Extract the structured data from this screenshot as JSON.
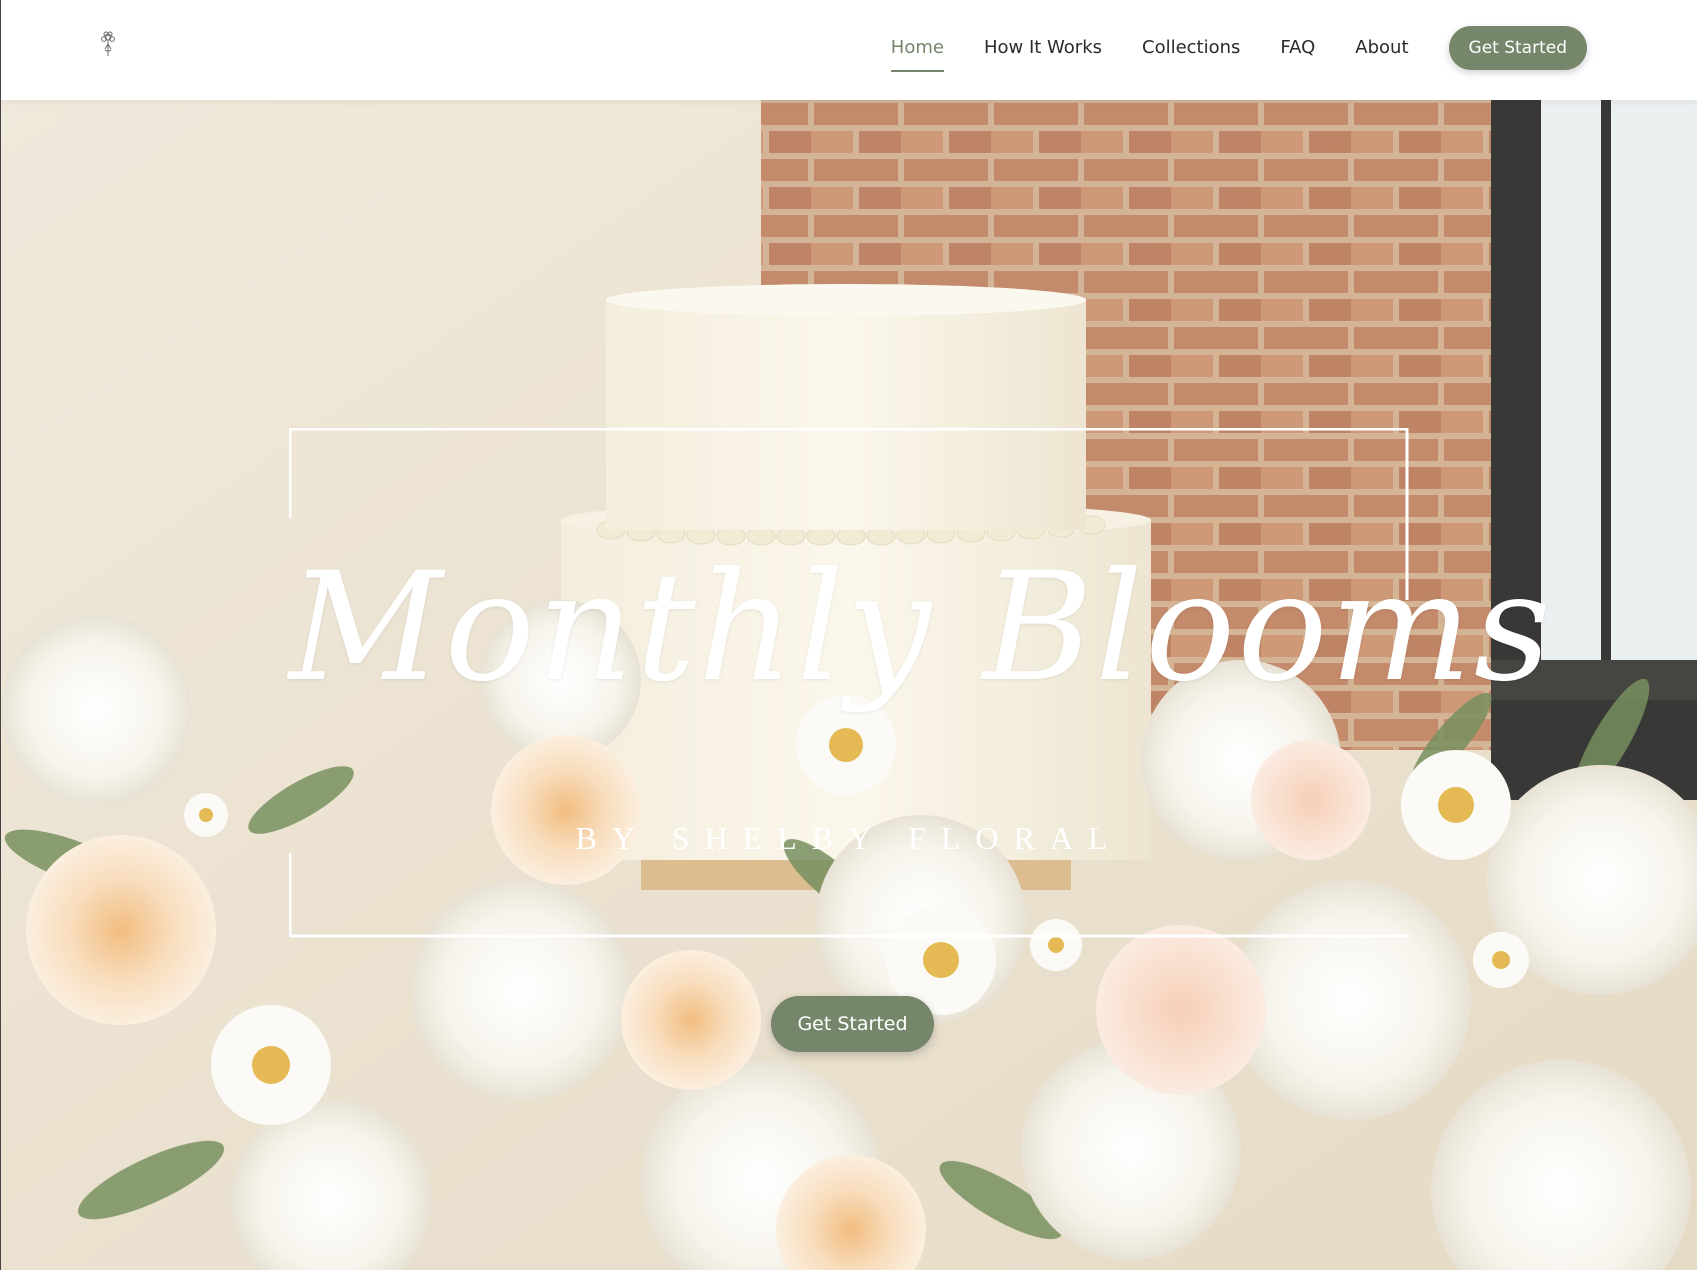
{
  "header": {
    "logo_icon": "flower-bouquet-icon",
    "nav": [
      {
        "label": "Home",
        "active": true
      },
      {
        "label": "How It Works",
        "active": false
      },
      {
        "label": "Collections",
        "active": false
      },
      {
        "label": "FAQ",
        "active": false
      },
      {
        "label": "About",
        "active": false
      }
    ],
    "cta_label": "Get Started"
  },
  "hero": {
    "title": "Monthly Blooms",
    "subtitle": "BY SHELBY FLORAL",
    "cta_label": "Get Started"
  },
  "colors": {
    "accent": "#76866a",
    "header_bg": "#ffffff",
    "hero_text": "#ffffff"
  }
}
